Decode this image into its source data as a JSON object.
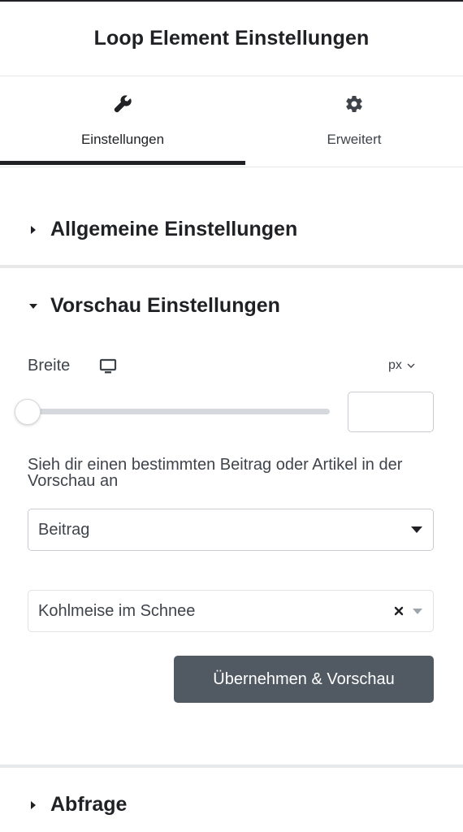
{
  "panel": {
    "title": "Loop Element Einstellungen"
  },
  "tabs": [
    {
      "label": "Einstellungen",
      "icon": "wrench-icon",
      "active": true
    },
    {
      "label": "Erweitert",
      "icon": "gear-icon",
      "active": false
    }
  ],
  "sections": {
    "general": {
      "title": "Allgemeine Einstellungen",
      "expanded": false
    },
    "preview": {
      "title": "Vorschau Einstellungen",
      "expanded": true
    },
    "query": {
      "title": "Abfrage",
      "expanded": false
    }
  },
  "preview": {
    "width_label": "Breite",
    "device_icon": "monitor-icon",
    "unit": "px",
    "width_value": "",
    "slider_level": 0,
    "description": "Sieh dir einen bestimmten Beitrag oder Artikel in der Vorschau an",
    "type_select": {
      "value": "Beitrag"
    },
    "post_select": {
      "value": "Kohlmeise im Schnee"
    },
    "apply_label": "Übernehmen & Vorschau"
  },
  "colors": {
    "text": "#1f2124",
    "muted": "#3f444b",
    "button_bg": "#515962",
    "divider": "#e6e8ea"
  }
}
